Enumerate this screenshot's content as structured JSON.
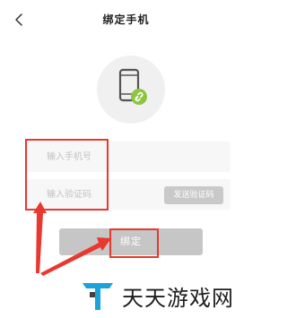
{
  "header": {
    "title": "绑定手机",
    "back_icon": "chevron-left-icon"
  },
  "avatar": {
    "icon": "phone-link-icon",
    "accent_color": "#8cc63f"
  },
  "form": {
    "phone_placeholder": "输入手机号",
    "code_placeholder": "输入验证码",
    "send_code_label": "发送验证码",
    "bind_label": "绑定"
  },
  "annotation": {
    "color": "#e8382f"
  },
  "watermark": {
    "text": "天天游戏网",
    "logo_color": "#1aa3d8"
  }
}
